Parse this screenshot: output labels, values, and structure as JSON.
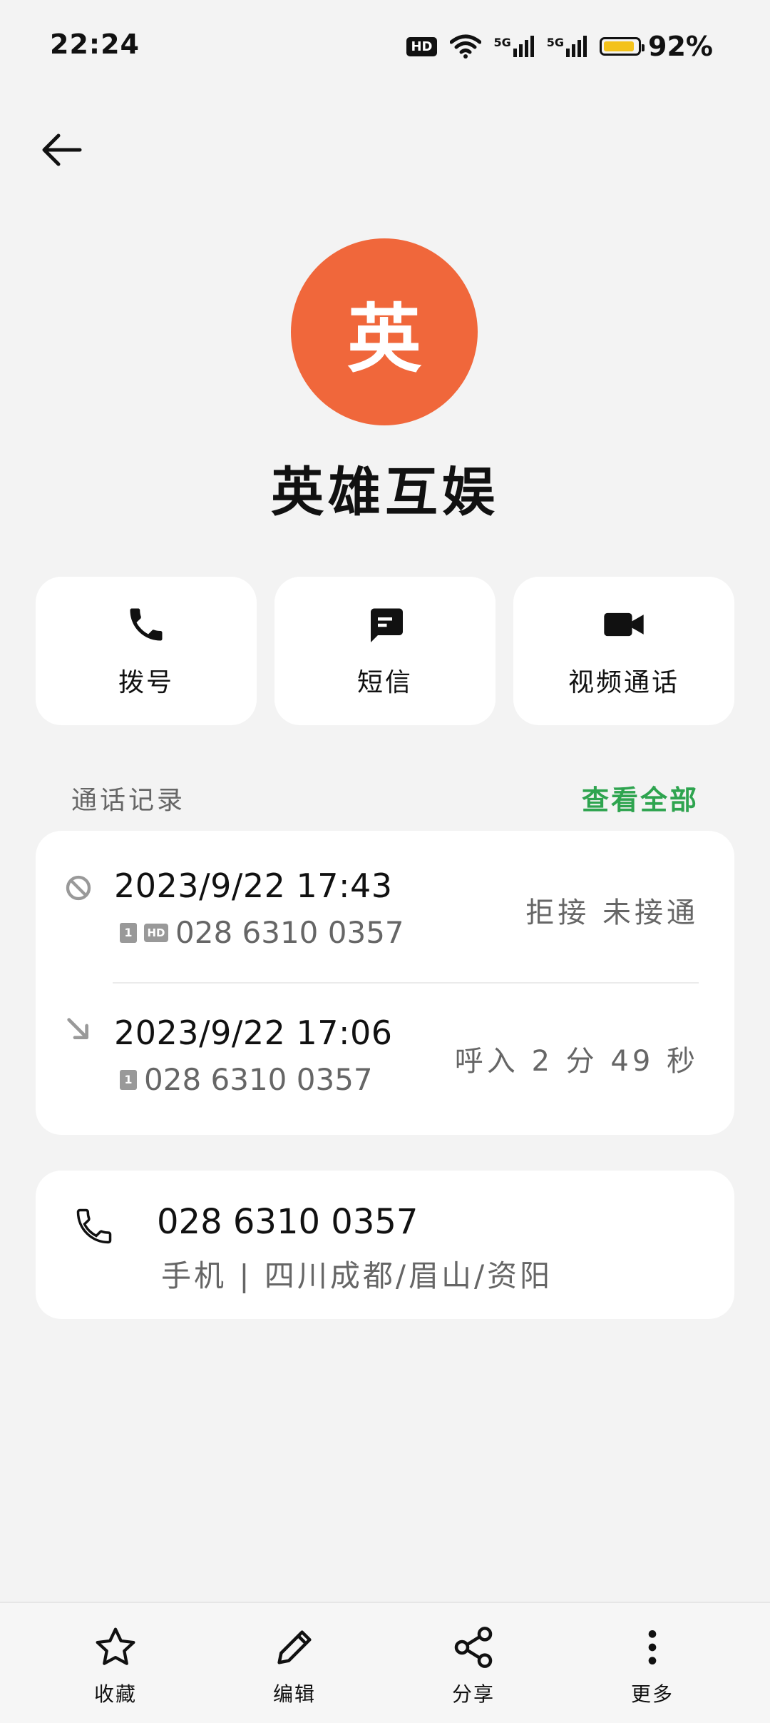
{
  "status_bar": {
    "time": "22:24",
    "hd": "HD",
    "net1": "5G",
    "net2": "5G",
    "battery": "92%",
    "battery_level": 0.92,
    "battery_color": "#f3c21b"
  },
  "contact": {
    "avatar_char": "英",
    "avatar_color": "#f0673b",
    "name": "英雄互娱"
  },
  "actions": [
    {
      "label": "拨号",
      "icon": "phone-icon"
    },
    {
      "label": "短信",
      "icon": "message-icon"
    },
    {
      "label": "视频通话",
      "icon": "video-icon"
    }
  ],
  "call_log": {
    "title": "通话记录",
    "view_all": "查看全部",
    "view_all_color": "#2ea44f",
    "entries": [
      {
        "datetime": "2023/9/22 17:43",
        "sim": "1",
        "hd": "HD",
        "number": "028 6310 0357",
        "status": "拒接 未接通",
        "icon": "blocked-icon"
      },
      {
        "datetime": "2023/9/22 17:06",
        "sim": "1",
        "number": "028 6310 0357",
        "status": "呼入 2 分 49 秒",
        "icon": "incoming-call-icon"
      }
    ]
  },
  "number_card": {
    "number": "028 6310 0357",
    "location": "手机 | 四川成都/眉山/资阳"
  },
  "bottom_bar": [
    {
      "label": "收藏",
      "icon": "star-icon"
    },
    {
      "label": "编辑",
      "icon": "pencil-icon"
    },
    {
      "label": "分享",
      "icon": "share-icon"
    },
    {
      "label": "更多",
      "icon": "more-vertical-icon"
    }
  ]
}
